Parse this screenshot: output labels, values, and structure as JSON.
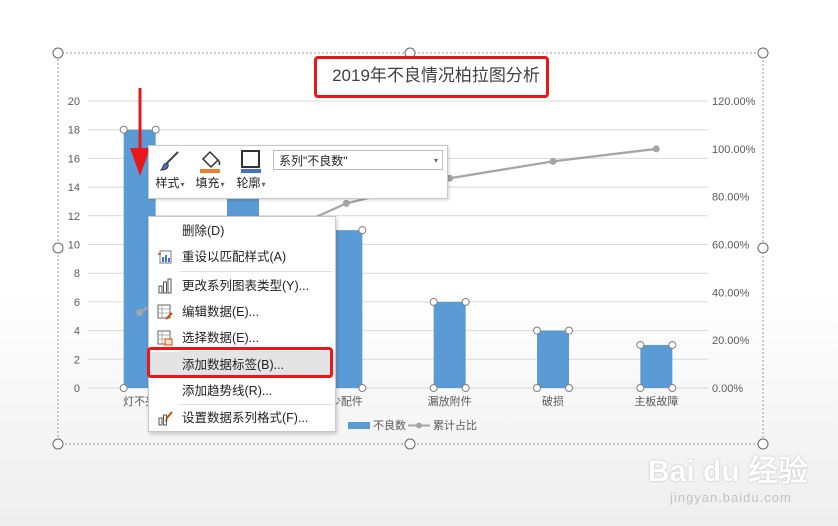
{
  "chart_data": {
    "type": "bar",
    "title": "2019年不良情况柏拉图分析",
    "categories": [
      "灯不亮",
      "",
      "少配件",
      "漏放附件",
      "破损",
      "主板故障"
    ],
    "category_labels_visible": [
      "灯不亮",
      "少配件",
      "漏放附件",
      "破损",
      "主板故障"
    ],
    "series": [
      {
        "name": "不良数",
        "type": "bar",
        "axis": "left",
        "color": "#5b9bd5",
        "values": [
          18,
          15,
          11,
          6,
          4,
          3
        ]
      },
      {
        "name": "累计占比",
        "type": "line",
        "axis": "right",
        "color": "#a5a5a5",
        "values": [
          0.3158,
          0.5789,
          0.7719,
          0.8772,
          0.9474,
          1.0
        ]
      }
    ],
    "ylim": [
      0,
      20
    ],
    "yticks": [
      "0",
      "2",
      "4",
      "6",
      "8",
      "10",
      "12",
      "14",
      "16",
      "18",
      "20"
    ],
    "y2lim": [
      0,
      1.2
    ],
    "y2ticks": [
      "0.00%",
      "20.00%",
      "40.00%",
      "60.00%",
      "80.00%",
      "100.00%",
      "120.00%"
    ],
    "grid": true,
    "legend_position": "bottom",
    "selected_series": "不良数"
  },
  "toolbar": {
    "style_label": "样式",
    "fill_label": "填充",
    "outline_label": "轮廓",
    "series_select_value": "系列\"不良数\""
  },
  "context_menu": {
    "items": [
      {
        "label": "删除(D)",
        "icon": "none"
      },
      {
        "label": "重设以匹配样式(A)",
        "icon": "reset-style-icon"
      },
      {
        "label": "更改系列图表类型(Y)...",
        "icon": "chart-type-icon"
      },
      {
        "label": "编辑数据(E)...",
        "icon": "edit-data-icon"
      },
      {
        "label": "选择数据(E)...",
        "icon": "select-data-icon"
      },
      {
        "label": "添加数据标签(B)...",
        "icon": "none"
      },
      {
        "label": "添加趋势线(R)...",
        "icon": "none"
      },
      {
        "label": "设置数据系列格式(F)...",
        "icon": "format-series-icon"
      }
    ],
    "highlighted_index": 5
  },
  "annotations": {
    "highlight_color": "#e8171c",
    "arrow_color": "#e8171c"
  },
  "watermark": {
    "logo": "Bai du 经验",
    "url": "jingyan.baidu.com"
  }
}
